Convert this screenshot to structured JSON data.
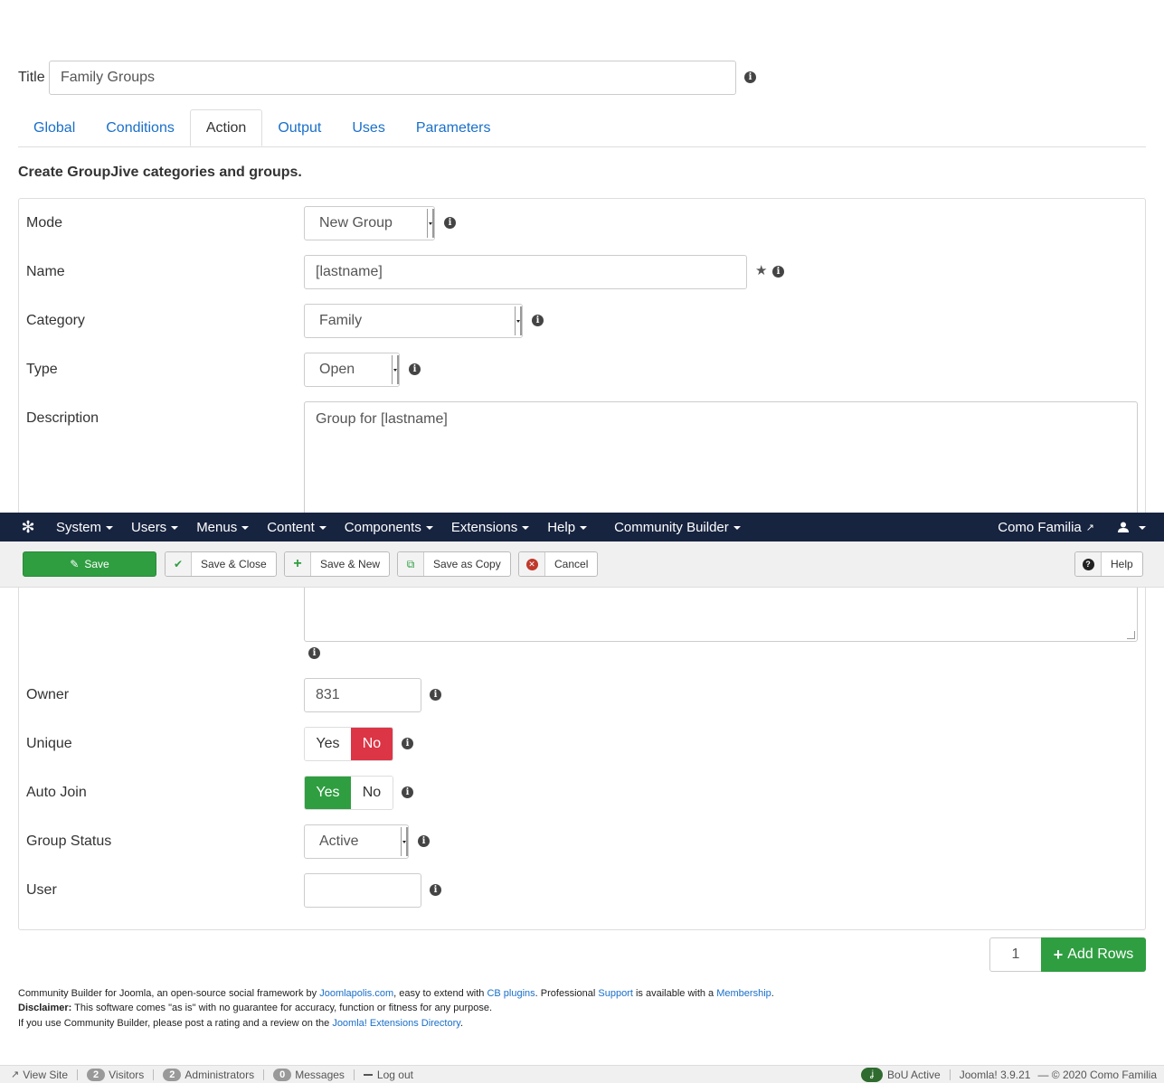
{
  "title_field": {
    "label": "Title",
    "value": "Family Groups"
  },
  "tabs": [
    {
      "label": "Global",
      "active": false
    },
    {
      "label": "Conditions",
      "active": false
    },
    {
      "label": "Action",
      "active": true
    },
    {
      "label": "Output",
      "active": false
    },
    {
      "label": "Uses",
      "active": false
    },
    {
      "label": "Parameters",
      "active": false
    }
  ],
  "section_heading": "Create GroupJive categories and groups.",
  "form": {
    "mode": {
      "label": "Mode",
      "value": "New Group"
    },
    "name": {
      "label": "Name",
      "value": "[lastname]"
    },
    "category": {
      "label": "Category",
      "value": "Family"
    },
    "type": {
      "label": "Type",
      "value": "Open"
    },
    "description": {
      "label": "Description",
      "value": "Group for [lastname]"
    },
    "owner": {
      "label": "Owner",
      "value": "831"
    },
    "unique": {
      "label": "Unique",
      "yes": "Yes",
      "no": "No",
      "selected": "No"
    },
    "auto_join": {
      "label": "Auto Join",
      "yes": "Yes",
      "no": "No",
      "selected": "Yes"
    },
    "group_status": {
      "label": "Group Status",
      "value": "Active"
    },
    "user": {
      "label": "User",
      "value": ""
    }
  },
  "add_rows": {
    "count": "1",
    "label": "Add Rows"
  },
  "navbar": {
    "items": [
      "System",
      "Users",
      "Menus",
      "Content",
      "Components",
      "Extensions",
      "Help",
      "Community Builder"
    ],
    "site_name": "Como Familia"
  },
  "toolbar": {
    "save": "Save",
    "save_close": "Save & Close",
    "save_new": "Save & New",
    "save_copy": "Save as Copy",
    "cancel": "Cancel",
    "help": "Help"
  },
  "footer": {
    "line1_a": "Community Builder for Joomla, an open-source social framework by ",
    "line1_link1": "Joomlapolis.com",
    "line1_b": ", easy to extend with ",
    "line1_link2": "CB plugins",
    "line1_c": ". Professional ",
    "line1_link3": "Support",
    "line1_d": " is available with a ",
    "line1_link4": "Membership",
    "line1_e": ".",
    "disclaimer_label": "Disclaimer:",
    "disclaimer_text": " This software comes \"as is\" with no guarantee for accuracy, function or fitness for any purpose.",
    "line3_a": "If you use Community Builder, please post a rating and a review on the ",
    "line3_link": "Joomla! Extensions Directory",
    "line3_b": "."
  },
  "status_bar": {
    "view_site": "View Site",
    "visitors_count": "2",
    "visitors": "Visitors",
    "admins_count": "2",
    "admins": "Administrators",
    "messages_count": "0",
    "messages": "Messages",
    "logout": "Log out",
    "bou": "BoU Active",
    "version": "Joomla! 3.9.21",
    "copyright": "— © 2020 Como Familia"
  },
  "colors": {
    "green": "#2f9e41",
    "red": "#dc3545",
    "navy": "#172440",
    "link": "#1a6fc9"
  }
}
